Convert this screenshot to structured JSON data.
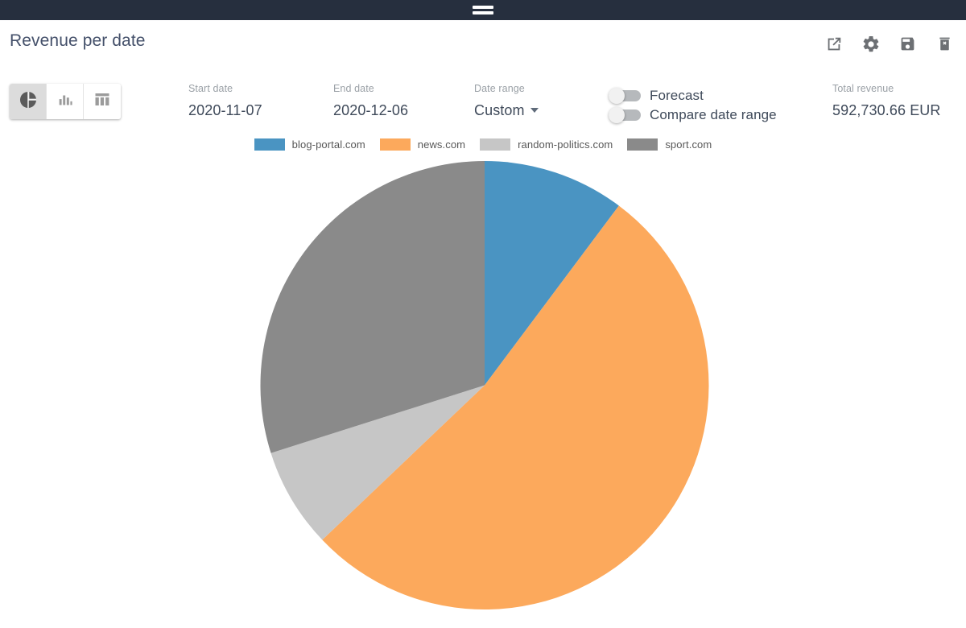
{
  "window": {
    "drag_handle_icon": "drag-handle-icon"
  },
  "header": {
    "title": "Revenue per date",
    "actions": [
      {
        "name": "open-external-button",
        "icon": "external-link-icon"
      },
      {
        "name": "settings-button",
        "icon": "gear-icon"
      },
      {
        "name": "save-button",
        "icon": "floppy-disk-icon"
      },
      {
        "name": "delete-button",
        "icon": "trash-x-icon"
      }
    ]
  },
  "chart_type_switcher": {
    "buttons": [
      {
        "name": "chart-type-pie",
        "icon": "pie-chart-icon",
        "active": true
      },
      {
        "name": "chart-type-bar",
        "icon": "bar-chart-icon",
        "active": false
      },
      {
        "name": "chart-type-table",
        "icon": "table-icon",
        "active": false
      }
    ]
  },
  "filters": {
    "start_date": {
      "label": "Start date",
      "value": "2020-11-07"
    },
    "end_date": {
      "label": "End date",
      "value": "2020-12-06"
    },
    "date_range": {
      "label": "Date range",
      "value": "Custom"
    }
  },
  "toggles": [
    {
      "label": "Forecast",
      "on": false
    },
    {
      "label": "Compare date range",
      "on": false
    }
  ],
  "total_revenue": {
    "label": "Total revenue",
    "value": "592,730.66 EUR"
  },
  "colors": {
    "blue": "#4a94c2",
    "orange": "#fca95c",
    "light_gray": "#c6c6c6",
    "dark_gray": "#8a8a8a",
    "topbar": "#262f3e",
    "title": "#44506a",
    "muted": "#9aa0a6"
  },
  "chart_data": {
    "type": "pie",
    "title": "Revenue per date",
    "unit": "EUR",
    "total": 592730.66,
    "legend_position": "top",
    "start_angle_deg": 0,
    "direction": "clockwise",
    "categories": [
      "blog-portal.com",
      "news.com",
      "random-politics.com",
      "sport.com"
    ],
    "values": [
      60458.5,
      312505.1,
      42812.2,
      176954.9
    ],
    "percentages": [
      10.2,
      52.7,
      7.2,
      29.9
    ],
    "angles_deg": [
      36.8,
      189.6,
      26.0,
      107.6
    ],
    "slice_colors": [
      "#4a94c2",
      "#fca95c",
      "#c6c6c6",
      "#8a8a8a"
    ],
    "xlabel": "",
    "ylabel": ""
  }
}
